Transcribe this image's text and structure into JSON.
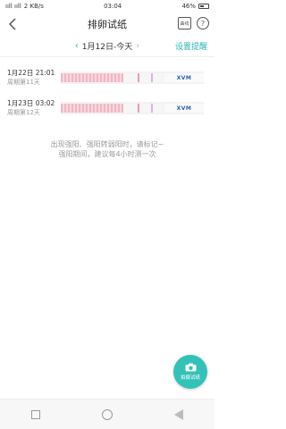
{
  "status": {
    "signal_text": "ııll ııll",
    "speed": "2 KB/s",
    "time": "03:04",
    "battery": "46%"
  },
  "header": {
    "title": "排卵试纸",
    "chart_label": "曲线",
    "help": "?"
  },
  "date_nav": {
    "current": "1月12日-今天",
    "settings": "设置提醒"
  },
  "records": [
    {
      "time": "1月22日 21:01",
      "cycle": "周期第11天",
      "strip_brand": "XVM"
    },
    {
      "time": "1月23日 03:02",
      "cycle": "周期第12天",
      "strip_brand": "XVM"
    }
  ],
  "hint": {
    "line1": "出现强阳、强阳转弱阳时，请标记~",
    "line2": "强阳期间，建议每4小时测一次"
  },
  "fab": {
    "label": "拍摄试纸"
  },
  "colors": {
    "accent": "#2ab4b4",
    "fab": "#33c2b7"
  }
}
